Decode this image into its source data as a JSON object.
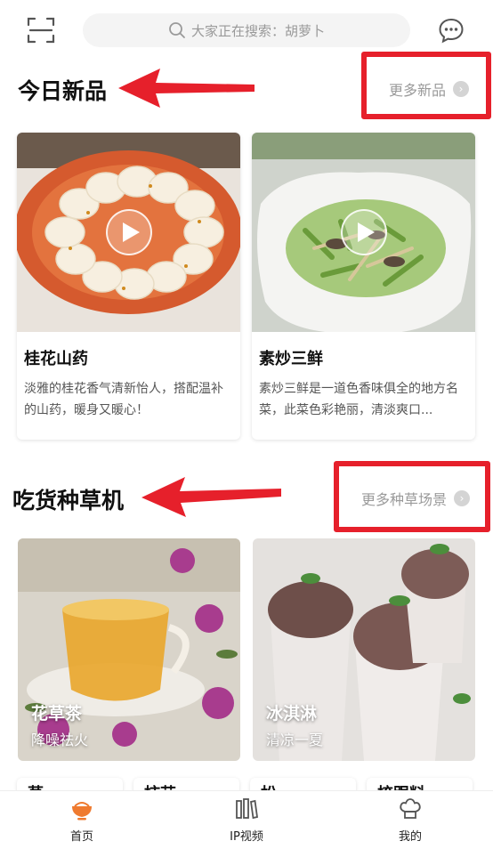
{
  "search": {
    "placeholder": "大家正在搜索：胡萝卜"
  },
  "sections": {
    "new": {
      "title": "今日新品",
      "more_label": "更多新品",
      "cards": [
        {
          "title": "桂花山药",
          "desc": "淡雅的桂花香气清新怡人，搭配温补的山药，暖身又暖心！"
        },
        {
          "title": "素炒三鲜",
          "desc": "素炒三鲜是一道色香味俱全的地方名菜，此菜色彩艳丽，清淡爽口..."
        }
      ]
    },
    "grass": {
      "title": "吃货种草机",
      "more_label": "更多种草场景",
      "scenes": [
        {
          "name": "花草茶",
          "sub": "降噪祛火"
        },
        {
          "name": "冰淇淋",
          "sub": "清凉一夏"
        }
      ],
      "peek": [
        "草",
        "柿芸",
        "松",
        "梳跟料"
      ]
    }
  },
  "nav": {
    "items": [
      {
        "label": "首页",
        "icon": "bowl-icon",
        "active": true
      },
      {
        "label": "IP视频",
        "icon": "books-icon",
        "active": false
      },
      {
        "label": "我的",
        "icon": "chef-hat-icon",
        "active": false
      }
    ]
  },
  "colors": {
    "accent": "#ef7a2f",
    "annotation": "#e6202b"
  }
}
